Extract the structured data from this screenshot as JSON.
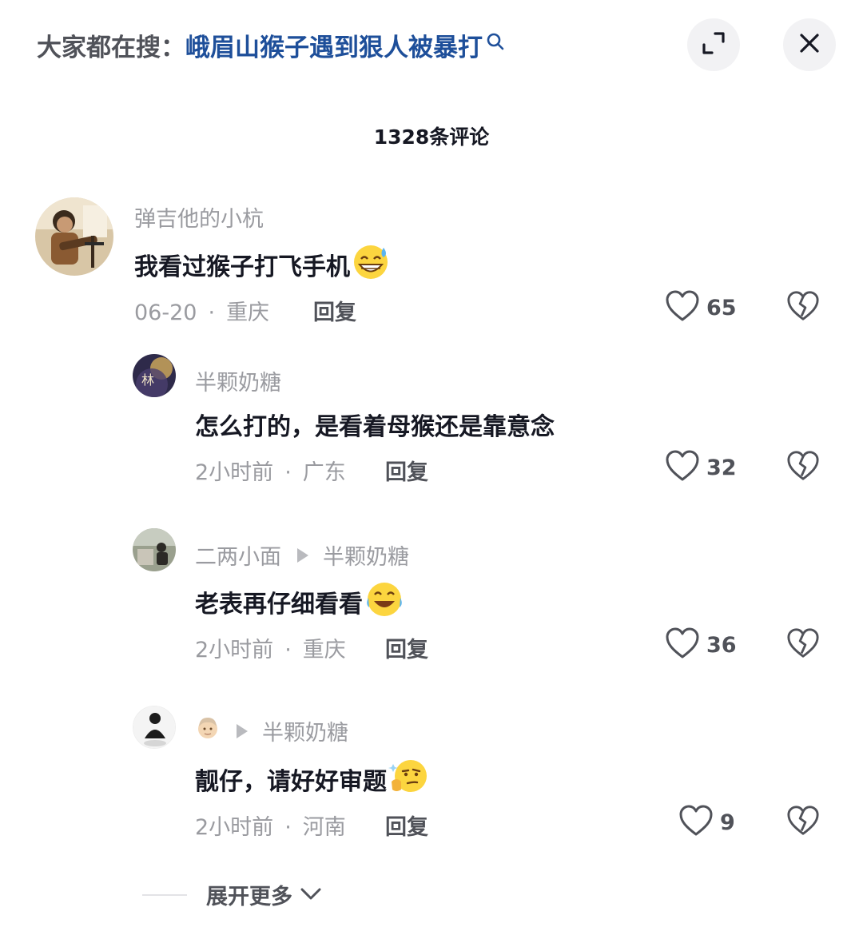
{
  "header": {
    "search_prefix": "大家都在搜：",
    "search_term": "峨眉山猴子遇到狠人被暴打",
    "expand_icon": "expand-icon",
    "close_icon": "close-icon"
  },
  "comment_count": "1328条评论",
  "comments": [
    {
      "username": "弹吉他的小杭",
      "text": "我看过猴子打飞手机",
      "emoji": "grinning-sweat-emoji",
      "date": "06-20",
      "location": "重庆",
      "reply_label": "回复",
      "likes": "65"
    },
    {
      "username": "半颗奶糖",
      "text": "怎么打的，是看着母猴还是靠意念",
      "date": "2小时前",
      "location": "广东",
      "reply_label": "回复",
      "likes": "32"
    },
    {
      "username": "二两小面",
      "reply_to": "半颗奶糖",
      "text": "老表再仔细看看",
      "emoji": "laughing-tears-emoji",
      "date": "2小时前",
      "location": "重庆",
      "reply_label": "回复",
      "likes": "36"
    },
    {
      "username_icon": "man-face-emoji",
      "reply_to": "半颗奶糖",
      "text": "靓仔，请好好审题",
      "emoji": "thinking-smirk-emoji",
      "date": "2小时前",
      "location": "河南",
      "reply_label": "回复",
      "likes": "9"
    }
  ],
  "expand_more": "展开更多",
  "colors": {
    "link": "#1e4f9a",
    "text_primary": "#161823",
    "text_secondary": "#9a9ba0",
    "button_bg": "#f2f2f4"
  }
}
